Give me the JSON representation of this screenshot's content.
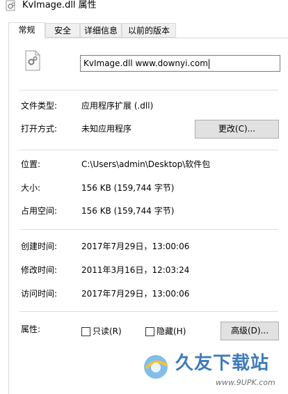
{
  "window": {
    "title": "KvImage.dll 属性"
  },
  "tabs": [
    {
      "label": "常规",
      "active": true
    },
    {
      "label": "安全",
      "active": false
    },
    {
      "label": "详细信息",
      "active": false
    },
    {
      "label": "以前的版本",
      "active": false
    }
  ],
  "file": {
    "name_value": "KvImage.dll www.downyi.com",
    "icon": "dll-file-icon"
  },
  "type_section": {
    "type_label": "文件类型:",
    "type_value": "应用程序扩展 (.dll)",
    "open_label": "打开方式:",
    "open_value": "未知应用程序",
    "change_button": "更改(C)..."
  },
  "location_section": {
    "location_label": "位置:",
    "location_value": "C:\\Users\\admin\\Desktop\\软件包",
    "size_label": "大小:",
    "size_value": "156 KB (159,744 字节)",
    "disk_label": "占用空间:",
    "disk_value": "156 KB (159,744 字节)"
  },
  "time_section": {
    "created_label": "创建时间:",
    "created_value": "2017年7月29日，13:00:06",
    "modified_label": "修改时间:",
    "modified_value": "2011年3月16日，12:03:24",
    "accessed_label": "访问时间:",
    "accessed_value": "2017年7月29日，13:00:06"
  },
  "attributes": {
    "label": "属性:",
    "readonly_label": "只读(R)",
    "readonly_checked": false,
    "hidden_label": "隐藏(H)",
    "hidden_checked": false,
    "advanced_button": "高级(D)..."
  },
  "watermark": {
    "brand": "久友下载站",
    "url": "www.9UPK.com"
  },
  "colors": {
    "tab_bg": "#f0f0f0",
    "border": "#d9d9d9",
    "button_bg": "#e1e1e1",
    "watermark": "#2a6db5"
  }
}
